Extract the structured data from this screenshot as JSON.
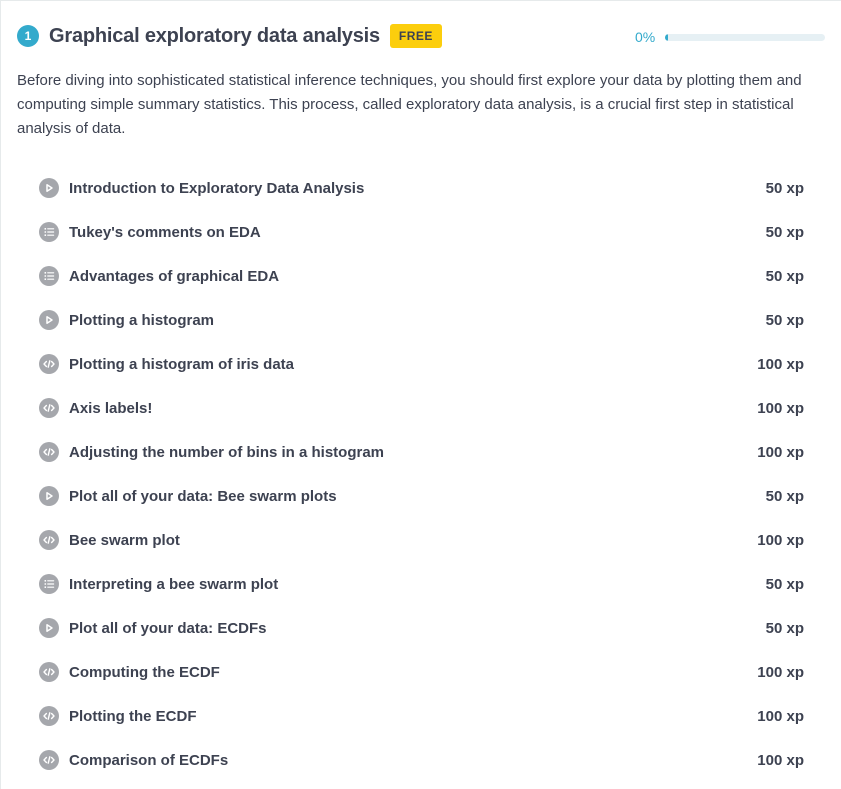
{
  "chapter": {
    "number": "1",
    "title": "Graphical exploratory data analysis",
    "badge": "FREE",
    "progress_label": "0%",
    "progress_value": 0,
    "description": "Before diving into sophisticated statistical inference techniques, you should first explore your data by plotting them and computing simple summary statistics. This process, called exploratory data analysis, is a crucial first step in statistical analysis of data."
  },
  "colors": {
    "accent": "#33aacc",
    "badge": "#fcce0d",
    "icon": "#a5a7ac",
    "text": "#3d4251"
  },
  "exercises": [
    {
      "type": "video",
      "icon": "play-icon",
      "title": "Introduction to Exploratory Data Analysis",
      "xp": "50 xp"
    },
    {
      "type": "multiple-choice",
      "icon": "list-icon",
      "title": "Tukey's comments on EDA",
      "xp": "50 xp"
    },
    {
      "type": "multiple-choice",
      "icon": "list-icon",
      "title": "Advantages of graphical EDA",
      "xp": "50 xp"
    },
    {
      "type": "video",
      "icon": "play-icon",
      "title": "Plotting a histogram",
      "xp": "50 xp"
    },
    {
      "type": "coding",
      "icon": "code-icon",
      "title": "Plotting a histogram of iris data",
      "xp": "100 xp"
    },
    {
      "type": "coding",
      "icon": "code-icon",
      "title": "Axis labels!",
      "xp": "100 xp"
    },
    {
      "type": "coding",
      "icon": "code-icon",
      "title": "Adjusting the number of bins in a histogram",
      "xp": "100 xp"
    },
    {
      "type": "video",
      "icon": "play-icon",
      "title": "Plot all of your data: Bee swarm plots",
      "xp": "50 xp"
    },
    {
      "type": "coding",
      "icon": "code-icon",
      "title": "Bee swarm plot",
      "xp": "100 xp"
    },
    {
      "type": "multiple-choice",
      "icon": "list-icon",
      "title": "Interpreting a bee swarm plot",
      "xp": "50 xp"
    },
    {
      "type": "video",
      "icon": "play-icon",
      "title": "Plot all of your data: ECDFs",
      "xp": "50 xp"
    },
    {
      "type": "coding",
      "icon": "code-icon",
      "title": "Computing the ECDF",
      "xp": "100 xp"
    },
    {
      "type": "coding",
      "icon": "code-icon",
      "title": "Plotting the ECDF",
      "xp": "100 xp"
    },
    {
      "type": "coding",
      "icon": "code-icon",
      "title": "Comparison of ECDFs",
      "xp": "100 xp"
    }
  ]
}
